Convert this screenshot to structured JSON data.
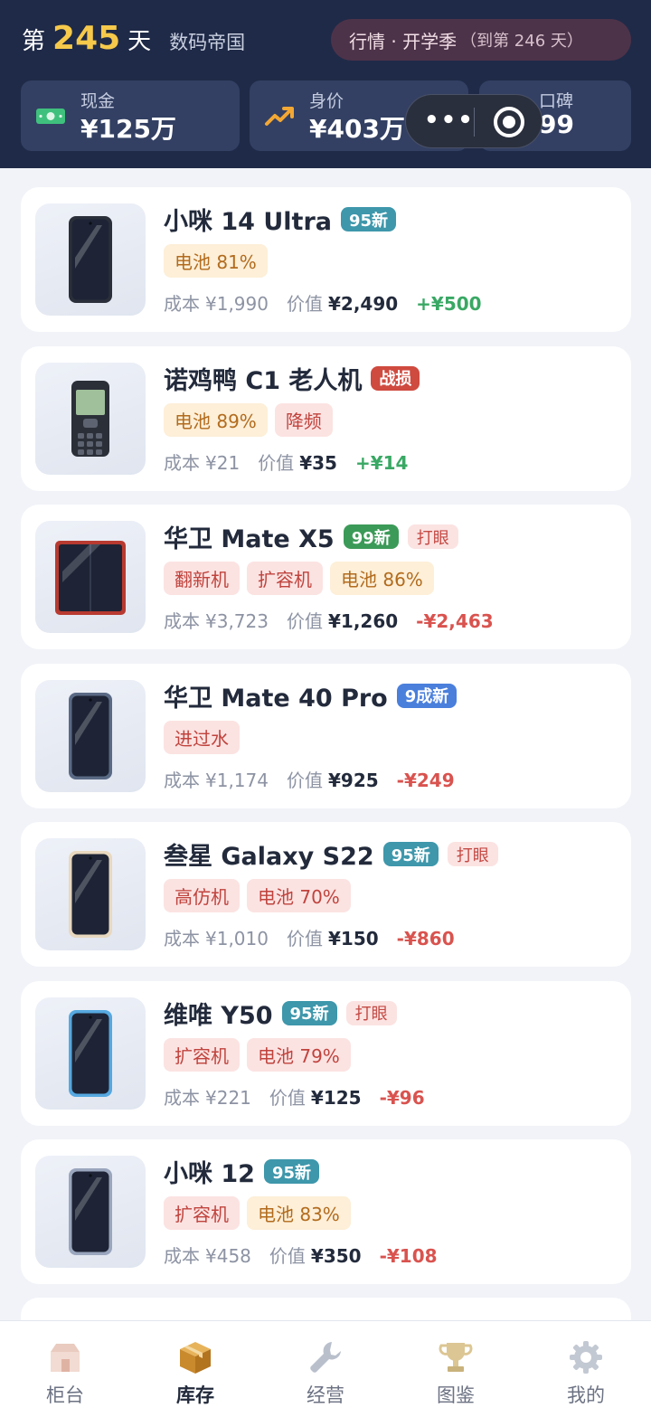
{
  "header": {
    "day_prefix": "第",
    "day_number": "245",
    "day_suffix": "天",
    "company": "数码帝国",
    "market_title": "行情 · 开学季",
    "market_until": "（到第 246 天）",
    "stats": [
      {
        "label": "现金",
        "value": "¥125万",
        "icon": "cash-icon",
        "color": "#3fc17d"
      },
      {
        "label": "身价",
        "value": "¥403万",
        "icon": "trend-up-icon",
        "color": "#f3a834"
      },
      {
        "label": "口碑",
        "value": "99",
        "icon": "star-icon",
        "color": "#f6c94b"
      }
    ],
    "capsule": {
      "more_icon": "more-icon",
      "dots": "•••",
      "close_icon": "target-icon"
    }
  },
  "items": [
    {
      "name": "小咪 14 Ultra",
      "condition": "95新",
      "condition_color": "#3e97ab",
      "eye": "",
      "tags": [
        {
          "text": "电池 81%",
          "kind": "battery"
        }
      ],
      "cost_label": "成本",
      "cost": "¥1,990",
      "value_label": "价值",
      "value": "¥2,490",
      "diff": "+¥500",
      "diff_color": "#39a864",
      "phone": {
        "type": "slab",
        "frame": "#2a2f3a",
        "screen": "#1e2435"
      }
    },
    {
      "name": "诺鸡鸭 C1 老人机",
      "condition": "战损",
      "condition_color": "#cf4a3f",
      "eye": "",
      "tags": [
        {
          "text": "电池 89%",
          "kind": "battery"
        },
        {
          "text": "降频",
          "kind": "bad"
        }
      ],
      "cost_label": "成本",
      "cost": "¥21",
      "value_label": "价值",
      "value": "¥35",
      "diff": "+¥14",
      "diff_color": "#39a864",
      "phone": {
        "type": "feature",
        "frame": "#2b2f38",
        "screen": "#9fc09a"
      }
    },
    {
      "name": "华卫 Mate X5",
      "condition": "99新",
      "condition_color": "#3c9a58",
      "eye": "打眼",
      "tags": [
        {
          "text": "翻新机",
          "kind": "bad"
        },
        {
          "text": "扩容机",
          "kind": "bad"
        },
        {
          "text": "电池 86%",
          "kind": "battery"
        }
      ],
      "cost_label": "成本",
      "cost": "¥3,723",
      "value_label": "价值",
      "value": "¥1,260",
      "diff": "-¥2,463",
      "diff_color": "#d9534f",
      "phone": {
        "type": "fold",
        "frame": "#b83a30",
        "screen": "#1e2435"
      }
    },
    {
      "name": "华卫 Mate 40 Pro",
      "condition": "9成新",
      "condition_color": "#4a7fdc",
      "eye": "",
      "tags": [
        {
          "text": "进过水",
          "kind": "bad"
        }
      ],
      "cost_label": "成本",
      "cost": "¥1,174",
      "value_label": "价值",
      "value": "¥925",
      "diff": "-¥249",
      "diff_color": "#d9534f",
      "phone": {
        "type": "slab",
        "frame": "#5a6a85",
        "screen": "#1e2435"
      }
    },
    {
      "name": "叁星 Galaxy S22",
      "condition": "95新",
      "condition_color": "#3e97ab",
      "eye": "打眼",
      "tags": [
        {
          "text": "高仿机",
          "kind": "bad"
        },
        {
          "text": "电池 70%",
          "kind": "bad"
        }
      ],
      "cost_label": "成本",
      "cost": "¥1,010",
      "value_label": "价值",
      "value": "¥150",
      "diff": "-¥860",
      "diff_color": "#d9534f",
      "phone": {
        "type": "slab",
        "frame": "#e8d8bf",
        "screen": "#1e2435"
      }
    },
    {
      "name": "维唯 Y50",
      "condition": "95新",
      "condition_color": "#3e97ab",
      "eye": "打眼",
      "tags": [
        {
          "text": "扩容机",
          "kind": "bad"
        },
        {
          "text": "电池 79%",
          "kind": "bad"
        }
      ],
      "cost_label": "成本",
      "cost": "¥221",
      "value_label": "价值",
      "value": "¥125",
      "diff": "-¥96",
      "diff_color": "#d9534f",
      "phone": {
        "type": "slab",
        "frame": "#56a8e0",
        "screen": "#1e2435"
      }
    },
    {
      "name": "小咪 12",
      "condition": "95新",
      "condition_color": "#3e97ab",
      "eye": "",
      "tags": [
        {
          "text": "扩容机",
          "kind": "bad"
        },
        {
          "text": "电池 83%",
          "kind": "battery"
        }
      ],
      "cost_label": "成本",
      "cost": "¥458",
      "value_label": "价值",
      "value": "¥350",
      "diff": "-¥108",
      "diff_color": "#d9534f",
      "phone": {
        "type": "slab",
        "frame": "#9aa6bd",
        "screen": "#1e2435"
      }
    }
  ],
  "nav": [
    {
      "label": "柜台",
      "icon": "store-icon",
      "active": false
    },
    {
      "label": "库存",
      "icon": "box-icon",
      "active": true
    },
    {
      "label": "经营",
      "icon": "wrench-icon",
      "active": false
    },
    {
      "label": "图鉴",
      "icon": "trophy-icon",
      "active": false
    },
    {
      "label": "我的",
      "icon": "gear-icon",
      "active": false
    }
  ]
}
